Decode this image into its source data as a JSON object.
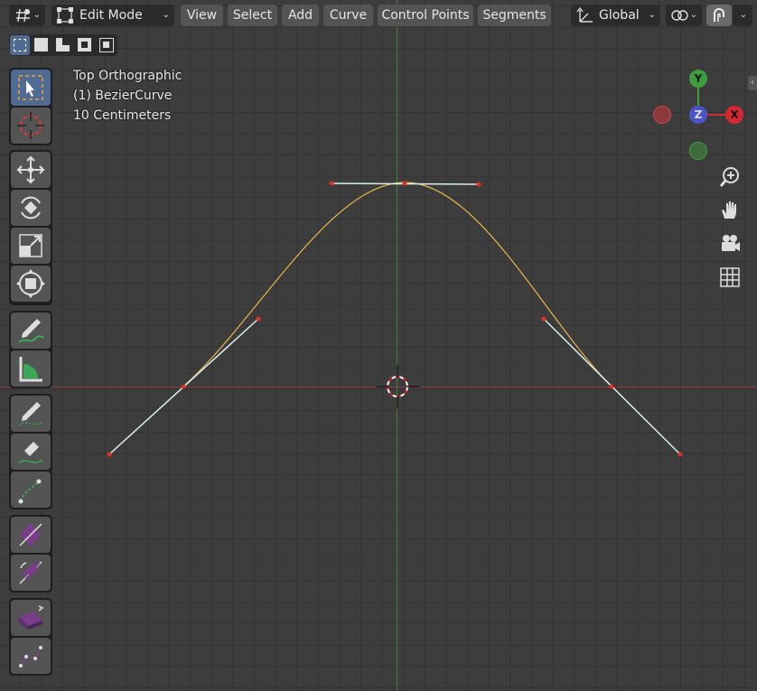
{
  "header": {
    "editor_type_icon": "grid-editor-icon",
    "mode_label": "Edit Mode",
    "menus": [
      "View",
      "Select",
      "Add",
      "Curve",
      "Control Points",
      "Segments"
    ],
    "orientation_label": "Global",
    "snap_icon": "snap-magnet-icon",
    "proportional_icon": "proportional-edit-icon"
  },
  "select_modes": [
    "select-new-icon",
    "select-extend-icon",
    "select-subtract-icon",
    "select-invert-icon",
    "select-intersect-icon"
  ],
  "overlay": {
    "view_name": "Top Orthographic",
    "object_name": "(1) BezierCurve",
    "scale": "10 Centimeters"
  },
  "gizmo": {
    "y_label": "Y",
    "z_label": "Z",
    "x_label": "X",
    "colors": {
      "x": "#d6262f",
      "y": "#3c9e3c",
      "z": "#4b54c7"
    }
  },
  "toolbar": {
    "tools": [
      "select-box-tool",
      "cursor-tool",
      "move-tool",
      "rotate-tool",
      "scale-tool",
      "transform-tool",
      "annotate-tool",
      "measure-tool",
      "draw-tool",
      "pen-tool",
      "extrude-tool",
      "radius-tool",
      "tilt-tool",
      "randomize-tool",
      "curve-shape-tool"
    ]
  },
  "nav_icons": [
    "zoom-icon",
    "pan-hand-icon",
    "camera-icon",
    "grid-view-icon"
  ],
  "colors": {
    "curve": "#e8b548",
    "handle": "#d8f0ec",
    "control_point": "#e03020",
    "active_tool": "#4f6a93"
  }
}
